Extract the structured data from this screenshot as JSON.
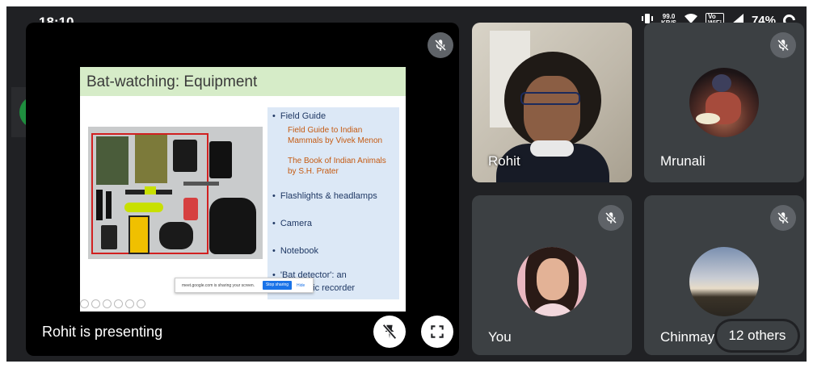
{
  "status_bar": {
    "time": "18:10",
    "speed_value": "99.0",
    "speed_unit": "KB/S",
    "vowifi_top": "Vo",
    "vowifi_bottom": "WiFi",
    "battery": "74%"
  },
  "presentation": {
    "presenting_label": "Rohit is presenting",
    "slide": {
      "title": "Bat-watching: Equipment",
      "items": [
        {
          "label": "Field Guide",
          "subs": [
            "Field Guide to Indian",
            "Mammals by Vivek Menon",
            "The Book of Indian Animals",
            "by S.H. Prater"
          ]
        },
        {
          "label": "Flashlights & headlamps"
        },
        {
          "label": "Camera"
        },
        {
          "label": "Notebook"
        },
        {
          "label": "'Bat detector': an",
          "label2": "ultrasonic recorder"
        }
      ],
      "share_bar": {
        "text": "meet.google.com is sharing your screen.",
        "stop_label": "Stop sharing",
        "hide_label": "Hide"
      }
    }
  },
  "participants": [
    {
      "name": "Rohit"
    },
    {
      "name": "Mrunali"
    },
    {
      "name": "You"
    },
    {
      "name": "Chinmay"
    }
  ],
  "others_label": "12 others",
  "colors": {
    "background": "#202124",
    "tile": "#3c4043",
    "accent_green": "#1e8e3e",
    "slide_title_bg": "#d6ecc8",
    "slide_list_bg": "#dce8f6"
  },
  "icons": {
    "mic_off": "mic-off-icon",
    "stop_presenting": "stop-presenting-icon",
    "fullscreen": "fullscreen-icon",
    "more": "more-options-icon"
  }
}
